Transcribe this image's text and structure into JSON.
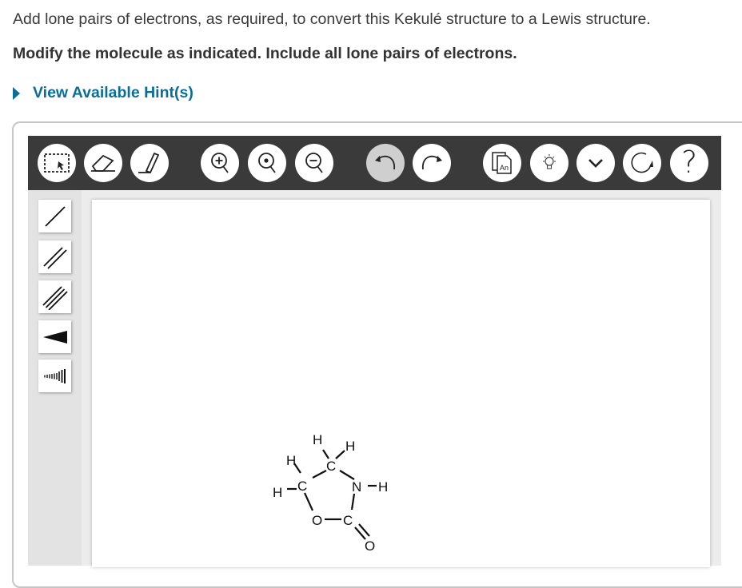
{
  "instructions": {
    "line1": "Add lone pairs of electrons, as required, to convert this Kekulé structure to a Lewis structure.",
    "line2": "Modify the molecule as indicated. Include all lone pairs of electrons."
  },
  "hint": {
    "label": "View Available Hint(s)"
  },
  "toolbar": {
    "tools": [
      {
        "name": "marquee-select-icon"
      },
      {
        "name": "eraser-icon"
      },
      {
        "name": "pen-icon"
      },
      {
        "name": "zoom-in-icon"
      },
      {
        "name": "zoom-fit-icon"
      },
      {
        "name": "zoom-out-icon"
      },
      {
        "name": "undo-icon",
        "pressed": true
      },
      {
        "name": "redo-icon"
      },
      {
        "name": "templates-icon",
        "text": "An"
      },
      {
        "name": "lightbulb-icon"
      },
      {
        "name": "chevron-down-icon"
      },
      {
        "name": "reset-icon"
      },
      {
        "name": "help-icon",
        "text": "?"
      }
    ]
  },
  "sidebar": {
    "tools": [
      "single-bond-icon",
      "double-bond-icon",
      "triple-bond-icon",
      "wedge-bond-icon",
      "hash-bond-icon"
    ]
  },
  "molecule": {
    "atoms": [
      "H",
      "H",
      "H",
      "C",
      "H",
      "C",
      "N",
      "H",
      "O",
      "C",
      "O"
    ]
  }
}
